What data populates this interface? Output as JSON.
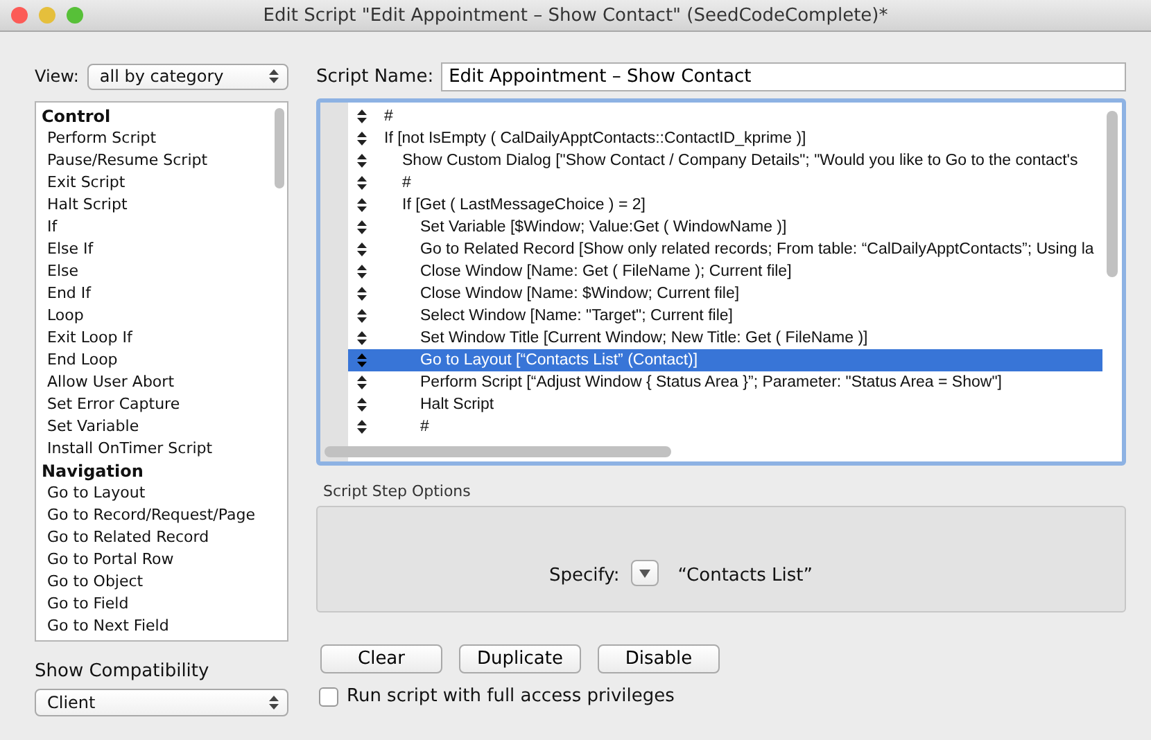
{
  "window": {
    "title": "Edit Script \"Edit Appointment – Show Contact\" (SeedCodeComplete)*"
  },
  "view": {
    "label": "View:",
    "value": "all by category"
  },
  "steps_list": [
    {
      "category": "Control",
      "items": [
        {
          "label": "Perform Script",
          "selected": false
        },
        {
          "label": "Pause/Resume Script",
          "selected": false
        },
        {
          "label": "Exit Script",
          "selected": false
        },
        {
          "label": "Halt Script",
          "selected": false
        },
        {
          "label": "If",
          "selected": false
        },
        {
          "label": "Else If",
          "selected": false
        },
        {
          "label": "Else",
          "selected": false
        },
        {
          "label": "End If",
          "selected": false
        },
        {
          "label": "Loop",
          "selected": false
        },
        {
          "label": "Exit Loop If",
          "selected": false
        },
        {
          "label": "End Loop",
          "selected": false
        },
        {
          "label": "Allow User Abort",
          "selected": false
        },
        {
          "label": "Set Error Capture",
          "selected": false
        },
        {
          "label": "Set Variable",
          "selected": false
        },
        {
          "label": "Install OnTimer Script",
          "selected": false
        }
      ]
    },
    {
      "category": "Navigation",
      "items": [
        {
          "label": "Go to Layout",
          "selected": false
        },
        {
          "label": "Go to Record/Request/Page",
          "selected": false
        },
        {
          "label": "Go to Related Record",
          "selected": false
        },
        {
          "label": "Go to Portal Row",
          "selected": false
        },
        {
          "label": "Go to Object",
          "selected": false
        },
        {
          "label": "Go to Field",
          "selected": false
        },
        {
          "label": "Go to Next Field",
          "selected": false
        }
      ]
    }
  ],
  "compatibility": {
    "label": "Show Compatibility",
    "value": "Client"
  },
  "script_name": {
    "label": "Script Name:",
    "value": "Edit Appointment – Show Contact"
  },
  "script_lines": [
    {
      "text": "#",
      "selected": false
    },
    {
      "text": "If [not IsEmpty ( CalDailyApptContacts::ContactID_kprime )]",
      "selected": false,
      "children": [
        {
          "text": "Show Custom Dialog [\"Show Contact / Company Details\"; \"Would you like to Go to the contact's",
          "selected": false
        },
        {
          "text": "#",
          "selected": false
        },
        {
          "text": "If [Get ( LastMessageChoice ) = 2]",
          "selected": false,
          "children": [
            {
              "text": "Set Variable [$Window; Value:Get ( WindowName )]",
              "selected": false
            },
            {
              "text": "Go to Related Record [Show only related records; From table: “CalDailyApptContacts”; Using la",
              "selected": false
            },
            {
              "text": "Close Window [Name: Get ( FileName ); Current file]",
              "selected": false
            },
            {
              "text": "Close Window [Name: $Window; Current file]",
              "selected": false
            },
            {
              "text": "Select Window [Name: \"Target\"; Current file]",
              "selected": false
            },
            {
              "text": "Set Window Title [Current Window; New Title: Get ( FileName )]",
              "selected": false
            },
            {
              "text": "Go to Layout [“Contacts List” (Contact)]",
              "selected": true
            },
            {
              "text": "Perform Script [“Adjust Window { Status Area }”; Parameter: \"Status Area = Show\"]",
              "selected": false
            },
            {
              "text": "Halt Script",
              "selected": false
            },
            {
              "text": "#",
              "selected": false
            }
          ]
        }
      ]
    }
  ],
  "step_options": {
    "title": "Script Step Options",
    "specify_label": "Specify:",
    "specify_value": "“Contacts List”"
  },
  "buttons": [
    "Clear",
    "Duplicate",
    "Disable"
  ],
  "full_access": {
    "label": "Run script with full access privileges",
    "checked": false
  }
}
